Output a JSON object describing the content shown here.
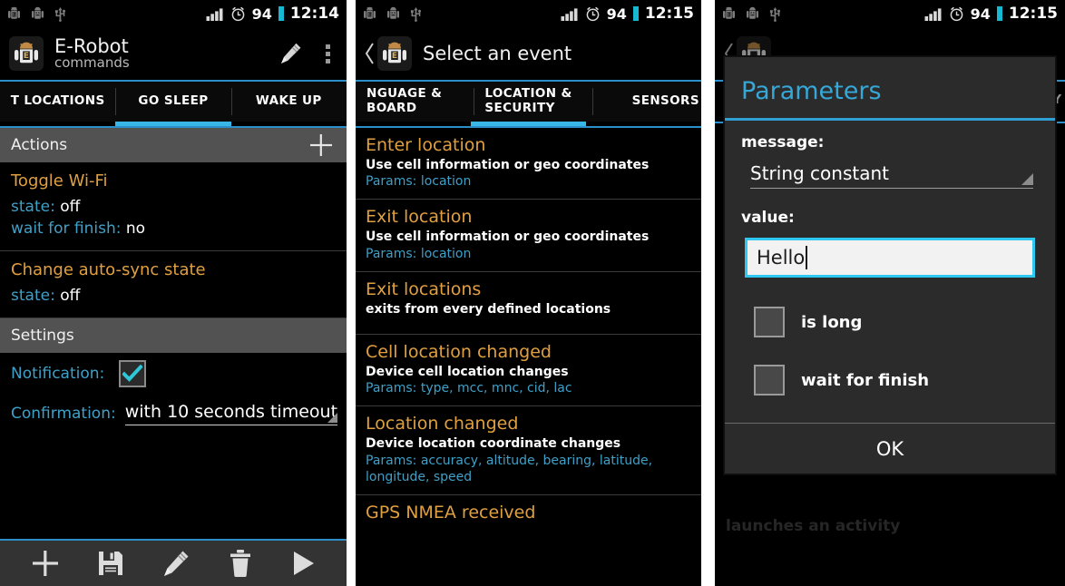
{
  "status_bar": {
    "battery": "94",
    "time_1": "12:14",
    "time_2": "12:15",
    "time_3": "12:15",
    "icons": [
      "android-debug-icon",
      "bug-icon",
      "usb-icon",
      "signal-bars-icon",
      "alarm-clock-icon",
      "battery-indicator-icon"
    ]
  },
  "colors": {
    "accent_blue": "#39b6e8",
    "rule_blue": "#2d8fc9",
    "title_orange": "#e0a040",
    "key_blue": "#3fa0c8",
    "header_gray": "#525252",
    "dialog_bg": "#2b2b2b",
    "field_focus": "#2ec8f0"
  },
  "panel1": {
    "app_title": "E-Robot",
    "app_subtitle": "commands",
    "action_bar_icons": [
      "edit-pencil-icon",
      "overflow-menu-icon"
    ],
    "tabs": [
      {
        "label": "T LOCATIONS",
        "selected": false
      },
      {
        "label": "GO SLEEP",
        "selected": true
      },
      {
        "label": "WAKE UP",
        "selected": false
      }
    ],
    "actions_header": "Actions",
    "add_icon": "plus-icon",
    "actions": [
      {
        "title": "Toggle Wi-Fi",
        "rows": [
          {
            "key": "state:",
            "value": "off"
          },
          {
            "key": "wait for finish:",
            "value": "no"
          }
        ]
      },
      {
        "title": "Change auto-sync state",
        "rows": [
          {
            "key": "state:",
            "value": "off"
          }
        ]
      }
    ],
    "settings_header": "Settings",
    "settings": {
      "notification_label": "Notification:",
      "notification_checked": true,
      "confirmation_label": "Confirmation:",
      "confirmation_value": "with 10 seconds timeout"
    },
    "toolbar": [
      {
        "icon": "plus-icon",
        "name": "add-button"
      },
      {
        "icon": "save-floppy-icon",
        "name": "save-button"
      },
      {
        "icon": "pencil-icon",
        "name": "edit-button"
      },
      {
        "icon": "trash-icon",
        "name": "delete-button"
      },
      {
        "icon": "play-icon",
        "name": "run-button"
      }
    ]
  },
  "panel2": {
    "back_icon": "back-chevron-icon",
    "title": "Select an event",
    "tabs": [
      {
        "line1": "NGUAGE &",
        "line2": "BOARD",
        "selected": false
      },
      {
        "line1": "LOCATION &",
        "line2": "SECURITY",
        "selected": true
      },
      {
        "line1": "SENSORS",
        "line2": "",
        "selected": false
      }
    ],
    "events": [
      {
        "title": "Enter location",
        "desc": "Use cell information or geo coordinates",
        "params": "Params: location"
      },
      {
        "title": "Exit location",
        "desc": "Use cell information or geo coordinates",
        "params": "Params: location"
      },
      {
        "title": "Exit locations",
        "desc": "exits from every defined locations",
        "params": ""
      },
      {
        "title": "Cell location changed",
        "desc": "Device cell location changes",
        "params": "Params: type, mcc, mnc, cid, lac"
      },
      {
        "title": "Location changed",
        "desc": "Device location coordinate changes",
        "params": "Params: accuracy, altitude, bearing, latitude, longitude, speed"
      },
      {
        "title": "GPS NMEA received",
        "desc": "",
        "params": ""
      }
    ]
  },
  "panel3": {
    "dialog_title": "Parameters",
    "message_label": "message:",
    "message_value": "String constant",
    "value_label": "value:",
    "value_text": "Hello",
    "checkboxes": [
      {
        "label": "is long",
        "checked": false
      },
      {
        "label": "wait for finish",
        "checked": false
      }
    ],
    "ok_label": "OK",
    "background_text": "launches an activity"
  }
}
